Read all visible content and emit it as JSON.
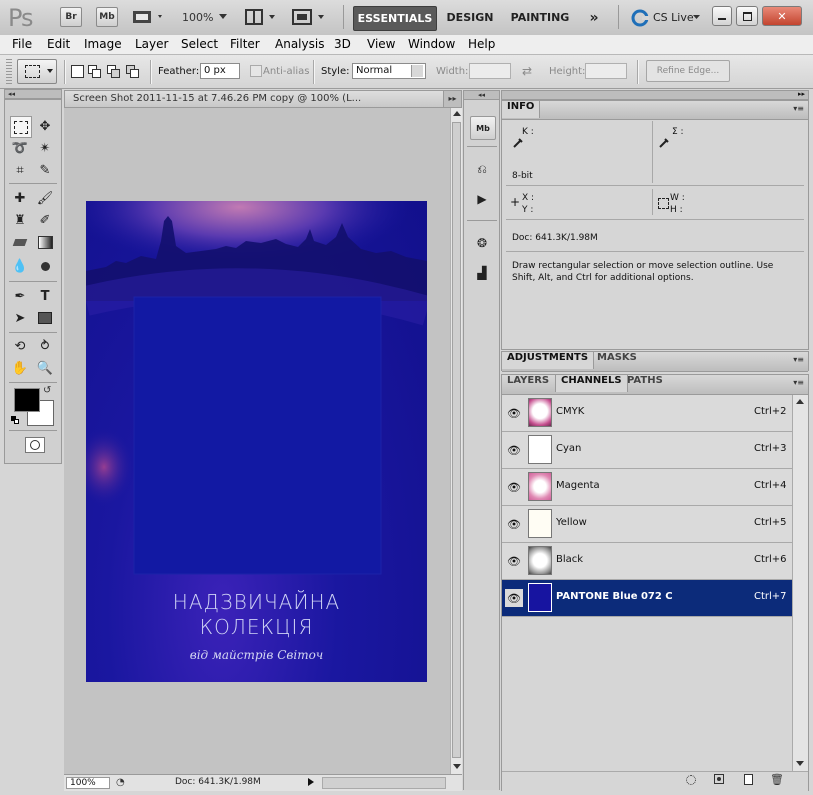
{
  "app": {
    "logo": "Ps",
    "bridge_btn": "Br",
    "minibridge_btn": "Mb",
    "zoom": "100%",
    "workspaces": [
      "ESSENTIALS",
      "DESIGN",
      "PAINTING"
    ],
    "more": "»",
    "cslive": "CS Live"
  },
  "menus": [
    "File",
    "Edit",
    "Image",
    "Layer",
    "Select",
    "Filter",
    "Analysis",
    "3D",
    "View",
    "Window",
    "Help"
  ],
  "options": {
    "feather_label": "Feather:",
    "feather_value": "0 px",
    "antialias_label": "Anti-alias",
    "style_label": "Style:",
    "style_value": "Normal",
    "width_label": "Width:",
    "height_label": "Height:",
    "refine_edge": "Refine Edge..."
  },
  "document": {
    "title": "Screen Shot 2011-11-15 at 7.46.26 PM copy @ 100% (L...",
    "zoom": "100%",
    "doc_info": "Doc: 641.3K/1.98M",
    "poster_line1": "НАДЗВИЧАЙНА",
    "poster_line2": "КОЛЕКЦІЯ",
    "poster_line3": "від майстрів Світоч"
  },
  "info_panel": {
    "tab": "INFO",
    "k_label": "K :",
    "sigma_label": "Σ :",
    "bit_depth": "8-bit",
    "x_label": "X :",
    "y_label": "Y :",
    "w_label": "W :",
    "h_label": "H :",
    "doc": "Doc: 641.3K/1.98M",
    "hint": "Draw rectangular selection or move selection outline.  Use Shift, Alt, and Ctrl for additional options."
  },
  "adj_tabs": [
    "ADJUSTMENTS",
    "MASKS"
  ],
  "layer_tabs": [
    "LAYERS",
    "CHANNELS",
    "PATHS"
  ],
  "channels": [
    {
      "name": "CMYK",
      "key": "Ctrl+2"
    },
    {
      "name": "Cyan",
      "key": "Ctrl+3"
    },
    {
      "name": "Magenta",
      "key": "Ctrl+4"
    },
    {
      "name": "Yellow",
      "key": "Ctrl+5"
    },
    {
      "name": "Black",
      "key": "Ctrl+6"
    },
    {
      "name": "PANTONE Blue 072 C",
      "key": "Ctrl+7"
    }
  ],
  "colors": {
    "selected_row": "#0c2b7a",
    "poster_blue": "#1a17a0",
    "essentials_bg": "#5a5a5a"
  }
}
